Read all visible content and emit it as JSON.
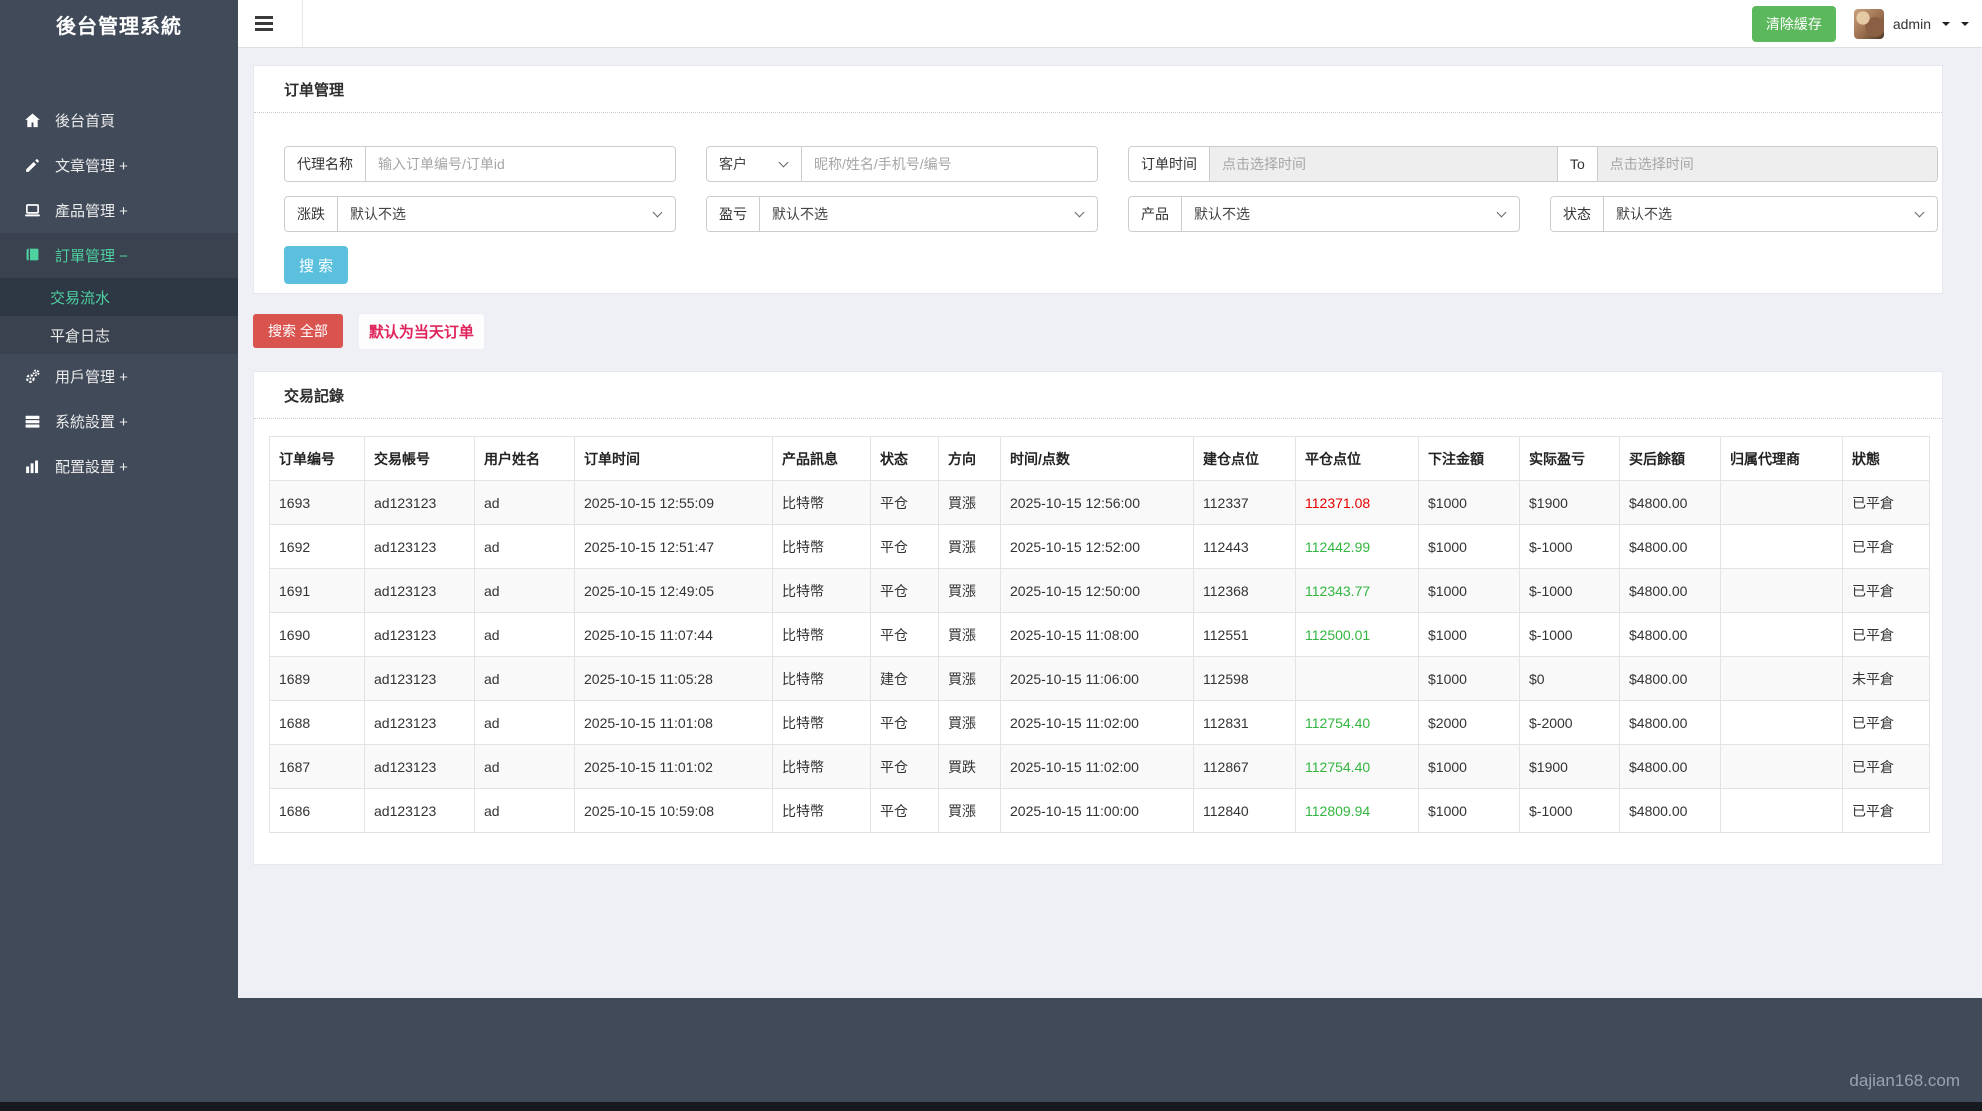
{
  "app": {
    "title": "後台管理系統",
    "watermark": "dajian168.com"
  },
  "topbar": {
    "clear_cache_label": "清除緩存",
    "username": "admin"
  },
  "sidebar": {
    "items": [
      {
        "label": "後台首頁",
        "icon": "home-icon"
      },
      {
        "label": "文章管理 +",
        "icon": "pencil-icon"
      },
      {
        "label": "產品管理 +",
        "icon": "laptop-icon"
      },
      {
        "label": "訂單管理 −",
        "icon": "book-icon",
        "active": true
      },
      {
        "label": "用戶管理 +",
        "icon": "gears-icon"
      },
      {
        "label": "系統設置 +",
        "icon": "server-icon"
      },
      {
        "label": "配置設置 +",
        "icon": "chart-icon"
      }
    ],
    "submenu": [
      {
        "label": "交易流水",
        "active": true
      },
      {
        "label": "平倉日志",
        "active": false
      }
    ]
  },
  "orders_panel": {
    "title": "订单管理",
    "filters": {
      "agent_label": "代理名称",
      "agent_placeholder": "输入订单编号/订单id",
      "customer_select": "客户",
      "customer_placeholder": "昵称/姓名/手机号/编号",
      "order_time_label": "订单时间",
      "time_placeholder": "点击选择时间",
      "to_label": "To",
      "updown_label": "涨跌",
      "profit_label": "盈亏",
      "product_label": "产品",
      "status_label": "状态",
      "default_option": "默认不选"
    },
    "search_button": "搜 索"
  },
  "actions": {
    "search_all_button": "搜索 全部",
    "note": "默认为当天订单"
  },
  "records_panel": {
    "title": "交易記錄",
    "table": {
      "columns": [
        {
          "key": "order_no",
          "label": "订单编号"
        },
        {
          "key": "account",
          "label": "交易帳号"
        },
        {
          "key": "user",
          "label": "用户姓名"
        },
        {
          "key": "order_time",
          "label": "订单时间"
        },
        {
          "key": "product",
          "label": "产品訊息"
        },
        {
          "key": "status",
          "label": "状态"
        },
        {
          "key": "direction",
          "label": "方向"
        },
        {
          "key": "time_point",
          "label": "时间/点数"
        },
        {
          "key": "open_point",
          "label": "建仓点位"
        },
        {
          "key": "close_point",
          "label": "平仓点位"
        },
        {
          "key": "bet",
          "label": "下注金額"
        },
        {
          "key": "profit",
          "label": "实际盈亏"
        },
        {
          "key": "balance",
          "label": "买后餘額"
        },
        {
          "key": "agent",
          "label": "归属代理商"
        },
        {
          "key": "state",
          "label": "狀態"
        }
      ],
      "rows": [
        {
          "order_no": "1693",
          "account": "ad123123",
          "user": "ad",
          "order_time": "2025-10-15 12:55:09",
          "product": "比特幣",
          "status": "平仓",
          "direction": "買漲",
          "time_point": "2025-10-15 12:56:00",
          "open_point": "112337",
          "close_point": "112371.08",
          "close_point_color": "#e60000",
          "bet": "$1000",
          "profit": "$1900",
          "balance": "$4800.00",
          "agent": "",
          "state": "已平倉"
        },
        {
          "order_no": "1692",
          "account": "ad123123",
          "user": "ad",
          "order_time": "2025-10-15 12:51:47",
          "product": "比特幣",
          "status": "平仓",
          "direction": "買漲",
          "time_point": "2025-10-15 12:52:00",
          "open_point": "112443",
          "close_point": "112442.99",
          "close_point_color": "#33b53f",
          "bet": "$1000",
          "profit": "$-1000",
          "balance": "$4800.00",
          "agent": "",
          "state": "已平倉"
        },
        {
          "order_no": "1691",
          "account": "ad123123",
          "user": "ad",
          "order_time": "2025-10-15 12:49:05",
          "product": "比特幣",
          "status": "平仓",
          "direction": "買漲",
          "time_point": "2025-10-15 12:50:00",
          "open_point": "112368",
          "close_point": "112343.77",
          "close_point_color": "#33b53f",
          "bet": "$1000",
          "profit": "$-1000",
          "balance": "$4800.00",
          "agent": "",
          "state": "已平倉"
        },
        {
          "order_no": "1690",
          "account": "ad123123",
          "user": "ad",
          "order_time": "2025-10-15 11:07:44",
          "product": "比特幣",
          "status": "平仓",
          "direction": "買漲",
          "time_point": "2025-10-15 11:08:00",
          "open_point": "112551",
          "close_point": "112500.01",
          "close_point_color": "#33b53f",
          "bet": "$1000",
          "profit": "$-1000",
          "balance": "$4800.00",
          "agent": "",
          "state": "已平倉"
        },
        {
          "order_no": "1689",
          "account": "ad123123",
          "user": "ad",
          "order_time": "2025-10-15 11:05:28",
          "product": "比特幣",
          "status": "建仓",
          "direction": "買漲",
          "time_point": "2025-10-15 11:06:00",
          "open_point": "112598",
          "close_point": "",
          "close_point_color": null,
          "bet": "$1000",
          "profit": "$0",
          "balance": "$4800.00",
          "agent": "",
          "state": "未平倉"
        },
        {
          "order_no": "1688",
          "account": "ad123123",
          "user": "ad",
          "order_time": "2025-10-15 11:01:08",
          "product": "比特幣",
          "status": "平仓",
          "direction": "買漲",
          "time_point": "2025-10-15 11:02:00",
          "open_point": "112831",
          "close_point": "112754.40",
          "close_point_color": "#33b53f",
          "bet": "$2000",
          "profit": "$-2000",
          "balance": "$4800.00",
          "agent": "",
          "state": "已平倉"
        },
        {
          "order_no": "1687",
          "account": "ad123123",
          "user": "ad",
          "order_time": "2025-10-15 11:01:02",
          "product": "比特幣",
          "status": "平仓",
          "direction": "買跌",
          "time_point": "2025-10-15 11:02:00",
          "open_point": "112867",
          "close_point": "112754.40",
          "close_point_color": "#33b53f",
          "bet": "$1000",
          "profit": "$1900",
          "balance": "$4800.00",
          "agent": "",
          "state": "已平倉"
        },
        {
          "order_no": "1686",
          "account": "ad123123",
          "user": "ad",
          "order_time": "2025-10-15 10:59:08",
          "product": "比特幣",
          "status": "平仓",
          "direction": "買漲",
          "time_point": "2025-10-15 11:00:00",
          "open_point": "112840",
          "close_point": "112809.94",
          "close_point_color": "#33b53f",
          "bet": "$1000",
          "profit": "$-1000",
          "balance": "$4800.00",
          "agent": "",
          "state": "已平倉"
        }
      ]
    }
  },
  "colors": {
    "sidebar_bg": "#404a59",
    "active_teal": "#4ed0a0",
    "content_bg": "#eef0f5",
    "clear_cache_green": "#5cb85c",
    "search_blue": "#5bc0de",
    "danger_red": "#d9534f",
    "note_red": "#e0245c",
    "value_red": "#e60000",
    "value_green": "#33b53f"
  }
}
